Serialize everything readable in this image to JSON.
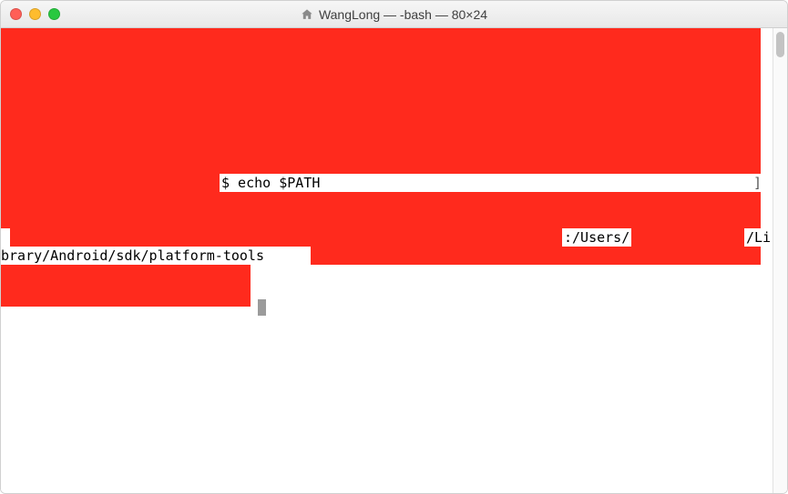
{
  "window": {
    "title": "WangLong — -bash — 80×24"
  },
  "terminal": {
    "command": "$ echo $PATH",
    "bracket": "]",
    "path_frag_users": ":/Users/",
    "path_frag_li": "/Li",
    "path_frag_sdk": "brary/Android/sdk/platform-tools"
  }
}
